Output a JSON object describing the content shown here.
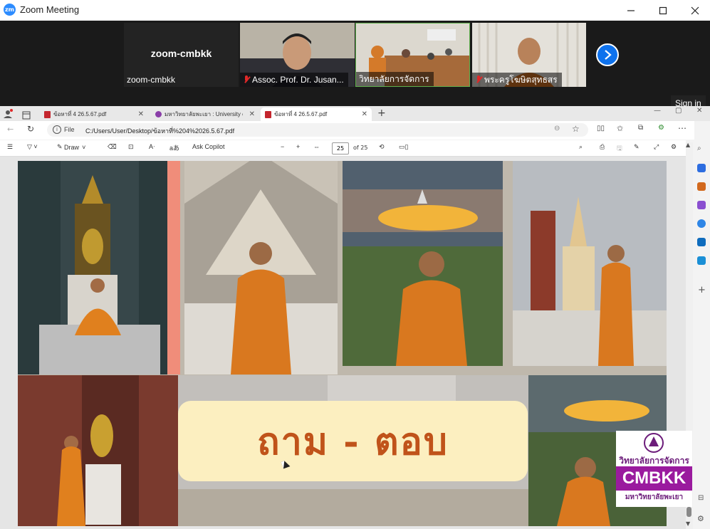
{
  "zoom": {
    "window_title": "Zoom Meeting",
    "logo_text": "zm",
    "sign_in": "Sign in",
    "participants": [
      {
        "name": "zoom-cmbkk",
        "display": "zoom-cmbkk",
        "muted": false,
        "video": false
      },
      {
        "name": "Assoc. Prof. Dr. Jusan...",
        "muted": true,
        "video": true
      },
      {
        "name": "วิทยาลัยการจัดการ",
        "muted": false,
        "video": true,
        "active": true
      },
      {
        "name": "พระครูโฆษิตสุทธสร",
        "muted": true,
        "video": true
      }
    ]
  },
  "edge": {
    "tabs": [
      {
        "title": "ข้อหาที่ 4 26.5.67.pdf",
        "active": false
      },
      {
        "title": "มหาวิทยาลัยพะเยา : University of Ph",
        "active": false
      },
      {
        "title": "ข้อหาที่ 4 26.5.67.pdf",
        "active": true
      }
    ],
    "address": {
      "scheme_label": "File",
      "url": "C:/Users/User/Desktop/ข้อหาที่%204%2026.5.67.pdf"
    },
    "pdf_toolbar": {
      "draw_label": "Draw",
      "copilot_label": "Ask Copilot",
      "page_current": "25",
      "page_of": "of 25"
    }
  },
  "slide": {
    "qa_text": "ถาม - ตอบ",
    "logo_thai_top": "วิทยาลัยการจัดการ",
    "logo_brand": "CMBKK",
    "logo_thai_bottom": "มหาวิทยาลัยพะเยา"
  },
  "colors": {
    "zoom_blue": "#2d8cff",
    "robe_orange": "#d9781f",
    "qa_text": "#c0531a",
    "banner_bg": "#fcefc0",
    "cmbkk_purple": "#9a1a9e"
  }
}
